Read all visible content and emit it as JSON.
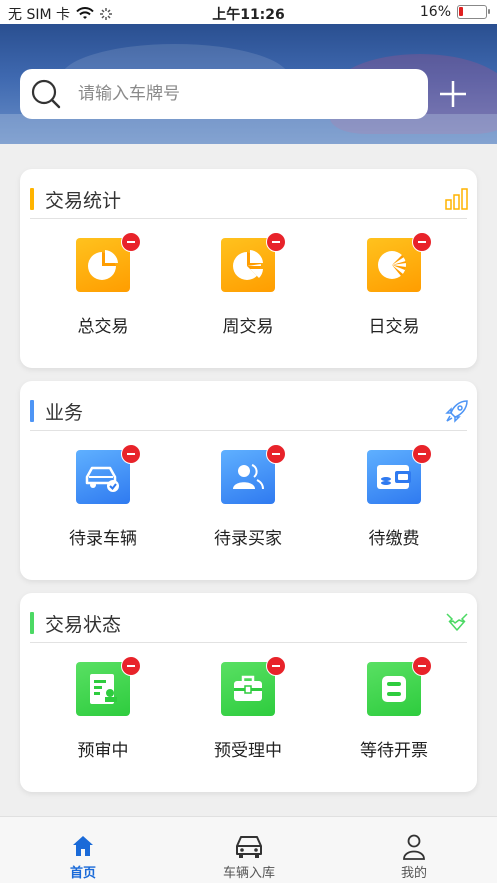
{
  "status_bar": {
    "carrier": "无 SIM 卡",
    "time": "上午11:26",
    "battery": "16%",
    "battery_level": 0.16
  },
  "search": {
    "placeholder": "请输入车牌号"
  },
  "sections": [
    {
      "title": "交易统计",
      "accent": "#ffb400",
      "corner_icon": "bar-chart-icon",
      "items": [
        {
          "label": "总交易",
          "icon": "pie-chart-icon"
        },
        {
          "label": "周交易",
          "icon": "pie-chart-week-icon"
        },
        {
          "label": "日交易",
          "icon": "pie-chart-day-icon"
        }
      ]
    },
    {
      "title": "业务",
      "accent": "#4e95f5",
      "corner_icon": "rocket-icon",
      "items": [
        {
          "label": "待录车辆",
          "icon": "car-icon"
        },
        {
          "label": "待录买家",
          "icon": "user-card-icon"
        },
        {
          "label": "待缴费",
          "icon": "wallet-icon"
        }
      ]
    },
    {
      "title": "交易状态",
      "accent": "#4cd964",
      "corner_icon": "handshake-icon",
      "items": [
        {
          "label": "预审中",
          "icon": "document-review-icon"
        },
        {
          "label": "预受理中",
          "icon": "briefcase-icon"
        },
        {
          "label": "等待开票",
          "icon": "ticket-icon"
        }
      ]
    }
  ],
  "tabbar": {
    "items": [
      {
        "label": "首页",
        "icon": "home-icon",
        "active": true
      },
      {
        "label": "车辆入库",
        "icon": "car-front-icon",
        "active": false
      },
      {
        "label": "我的",
        "icon": "person-icon",
        "active": false
      }
    ]
  },
  "colors": {
    "primary_blue": "#1a6ad8",
    "badge_red": "#e8232a"
  }
}
